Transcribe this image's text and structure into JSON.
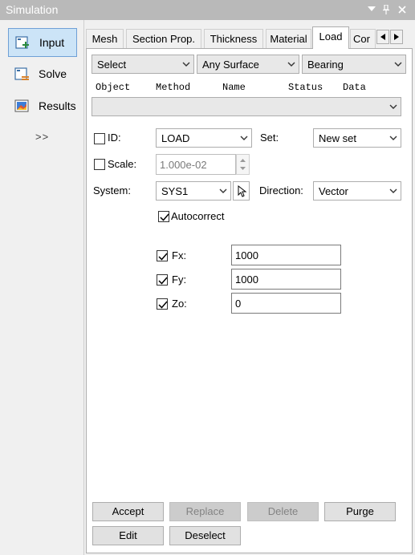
{
  "window": {
    "title": "Simulation",
    "icons": [
      "dropdown-icon",
      "pin-icon",
      "close-icon"
    ]
  },
  "nav": {
    "items": [
      {
        "label": "Input",
        "icon": "input-icon",
        "selected": true
      },
      {
        "label": "Solve",
        "icon": "solve-icon",
        "selected": false
      },
      {
        "label": "Results",
        "icon": "results-icon",
        "selected": false
      }
    ],
    "more": ">>"
  },
  "tabs": [
    {
      "label": "Mesh",
      "active": false
    },
    {
      "label": "Section Prop.",
      "active": false
    },
    {
      "label": "Thickness",
      "active": false
    },
    {
      "label": "Material",
      "active": false
    },
    {
      "label": "Load",
      "active": true
    },
    {
      "label": "Cor",
      "active": false
    }
  ],
  "filters": {
    "select": "Select",
    "surface": "Any Surface",
    "type": "Bearing"
  },
  "columns": [
    "Object",
    "Method",
    "Name",
    "Status",
    "Data"
  ],
  "object_combo": "",
  "form": {
    "id_label": "ID:",
    "id_checked": false,
    "id_value": "LOAD",
    "set_label": "Set:",
    "set_value": "New set",
    "scale_label": "Scale:",
    "scale_checked": false,
    "scale_value": "1.000e-02",
    "system_label": "System:",
    "system_value": "SYS1",
    "direction_label": "Direction:",
    "direction_value": "Vector",
    "autocorrect_label": "Autocorrect",
    "autocorrect_checked": true,
    "fx_label": "Fx:",
    "fx_value": "1000",
    "fy_label": "Fy:",
    "fy_value": "1000",
    "zo_label": "Zo:",
    "zo_value": "0"
  },
  "buttons": {
    "accept": "Accept",
    "replace": "Replace",
    "delete": "Delete",
    "purge": "Purge",
    "edit": "Edit",
    "deselect": "Deselect"
  },
  "colors": {
    "titlebar": "#b9b9b9",
    "nav_selected": "#cce4f7",
    "nav_selected_border": "#6fa0d6"
  }
}
